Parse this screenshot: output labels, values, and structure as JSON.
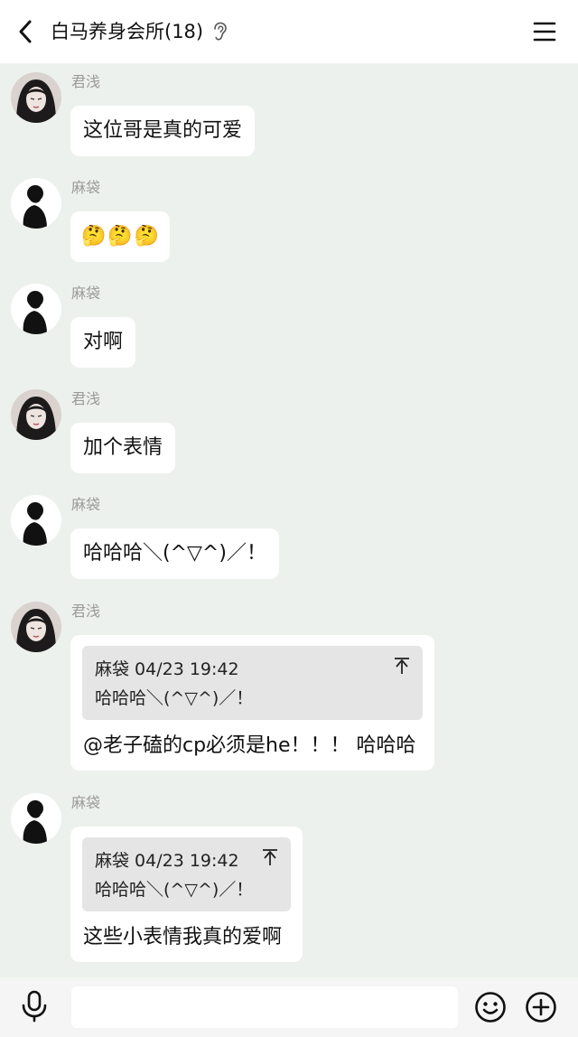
{
  "header": {
    "title": "白马养身会所(18)"
  },
  "messages": [
    {
      "sender": "君浅",
      "text": "这位哥是真的可爱"
    },
    {
      "sender": "麻袋",
      "emoji": [
        "🤔",
        "🤔",
        "🤔"
      ]
    },
    {
      "sender": "麻袋",
      "text": "对啊"
    },
    {
      "sender": "君浅",
      "text": "加个表情"
    },
    {
      "sender": "麻袋",
      "text": "哈哈哈＼(^▽^)／！"
    },
    {
      "sender": "君浅",
      "quote_meta": "麻袋 04/23 19:42",
      "quote_text": "哈哈哈＼(^▽^)／！",
      "text": "@老子磕的cp必须是he！！！ 哈哈哈"
    },
    {
      "sender": "麻袋",
      "quote_meta": "麻袋 04/23 19:42",
      "quote_text": "哈哈哈＼(^▽^)／！",
      "text": "这些小表情我真的爱啊"
    }
  ],
  "input": {
    "placeholder": ""
  },
  "icons": {
    "back": "chevron-left-icon",
    "ear": "ear-icon",
    "menu": "hamburger-menu-icon",
    "mic": "microphone-icon",
    "emoji": "smiley-icon",
    "plus": "plus-circle-icon"
  },
  "colors": {
    "chat_background": "#edf1ed",
    "bubble": "#ffffff",
    "quote_background": "#e5e5e5",
    "sender_name": "#9a9a9a"
  }
}
